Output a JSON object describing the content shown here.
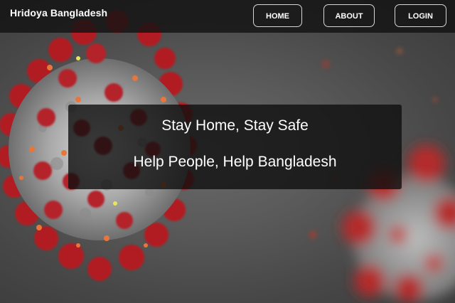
{
  "navbar": {
    "brand": "Hridoya Bangladesh",
    "links": [
      {
        "label": "HOME"
      },
      {
        "label": "ABOUT"
      },
      {
        "label": "LOGIN"
      }
    ]
  },
  "hero": {
    "line1": "Stay Home, Stay Safe",
    "line2": "Help People, Help Bangladesh",
    "image": "coronavirus-illustration",
    "colors": {
      "virus_spikes": "#b82024",
      "virus_core": "#bdbdbd",
      "background": "#4d4d4d",
      "overlay": "#0f0f0f"
    }
  }
}
